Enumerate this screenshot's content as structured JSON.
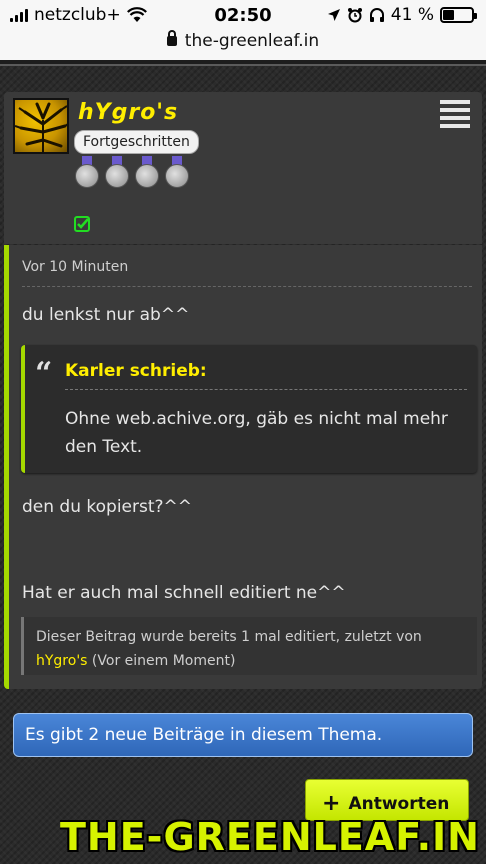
{
  "statusbar": {
    "carrier": "netzclub+",
    "time": "02:50",
    "battery_percent": "41 %",
    "battery_level": 0.41,
    "url": "the-greenleaf.in"
  },
  "author": {
    "name": "hYgro's",
    "rank": "Fortgeschritten",
    "medal_count": 4
  },
  "post": {
    "time": "Vor 10 Minuten",
    "text1": "du lenkst nur ab^^",
    "quote": {
      "author": "Karler schrieb:",
      "text": "Ohne web.achive.org, gäb es nicht mal mehr den Text."
    },
    "text2": "den du kopierst?^^",
    "text3": "Hat er auch mal schnell editiert ne^^",
    "edit_note": {
      "prefix": "Dieser Beitrag wurde bereits 1 mal editiert, zuletzt von",
      "user": "hYgro's",
      "suffix": "(Vor einem Moment)"
    }
  },
  "notice": {
    "text": "Es gibt 2 neue Beiträge in diesem Thema."
  },
  "reply_button": {
    "label": "Antworten"
  },
  "watermark": {
    "text": "THE-GREENLEAF.IN"
  },
  "colors": {
    "accent": "#a5d900",
    "username": "#ffee00",
    "notice": "#3b76c8"
  }
}
